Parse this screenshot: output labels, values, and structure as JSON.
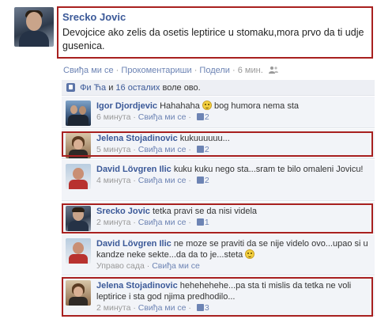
{
  "post": {
    "author": "Srecko Jovic",
    "text": "Devojcice ako zelis da osetis leptirice u stomaku,mora prvo da ti udje gusenica.",
    "actions": {
      "like": "Свиђа ми се",
      "comment": "Прокоментариши",
      "share": "Подели",
      "time": "6 мин."
    }
  },
  "likes": {
    "names": "Фи Ћа",
    "and": "и",
    "others": "16 осталих",
    "suffix": "воле ово."
  },
  "comments": [
    {
      "author": "Igor Djordjevic",
      "text": "Hahahaha",
      "text2": "bog humora nema sta",
      "time": "6 минута",
      "like": "Свиђа ми се",
      "likes": "2"
    },
    {
      "author": "Jelena Stojadinovic",
      "text": "kukuuuuuu...",
      "time": "5 минута",
      "like": "Свиђа ми се",
      "likes": "2"
    },
    {
      "author": "David Lövgren Ilic",
      "text": "kuku kuku nego sta...sram te bilo omaleni Jovicu!",
      "time": "4 минута",
      "like": "Свиђа ми се",
      "likes": "2"
    },
    {
      "author": "Srecko Jovic",
      "text": "tetka pravi se da nisi videla",
      "time": "2 минута",
      "like": "Свиђа ми се",
      "likes": "1"
    },
    {
      "author": "David Lövgren Ilic",
      "text": "ne moze se praviti da se nije videlo ovo...upao si u kandze neke sekte...da da to je...steta",
      "time": "Управо сада",
      "like": "Свиђа ми се",
      "likes": ""
    },
    {
      "author": "Jelena Stojadinovic",
      "text": "hehehehehe...pa sta ti mislis da tetka ne voli leptirice i sta god njima predhodilo...",
      "time": "2 минута",
      "like": "Свиђа ми се",
      "likes": "3"
    }
  ],
  "colors": {
    "highlight": "#a8201f",
    "link": "#3b5998",
    "meta": "#999999"
  }
}
